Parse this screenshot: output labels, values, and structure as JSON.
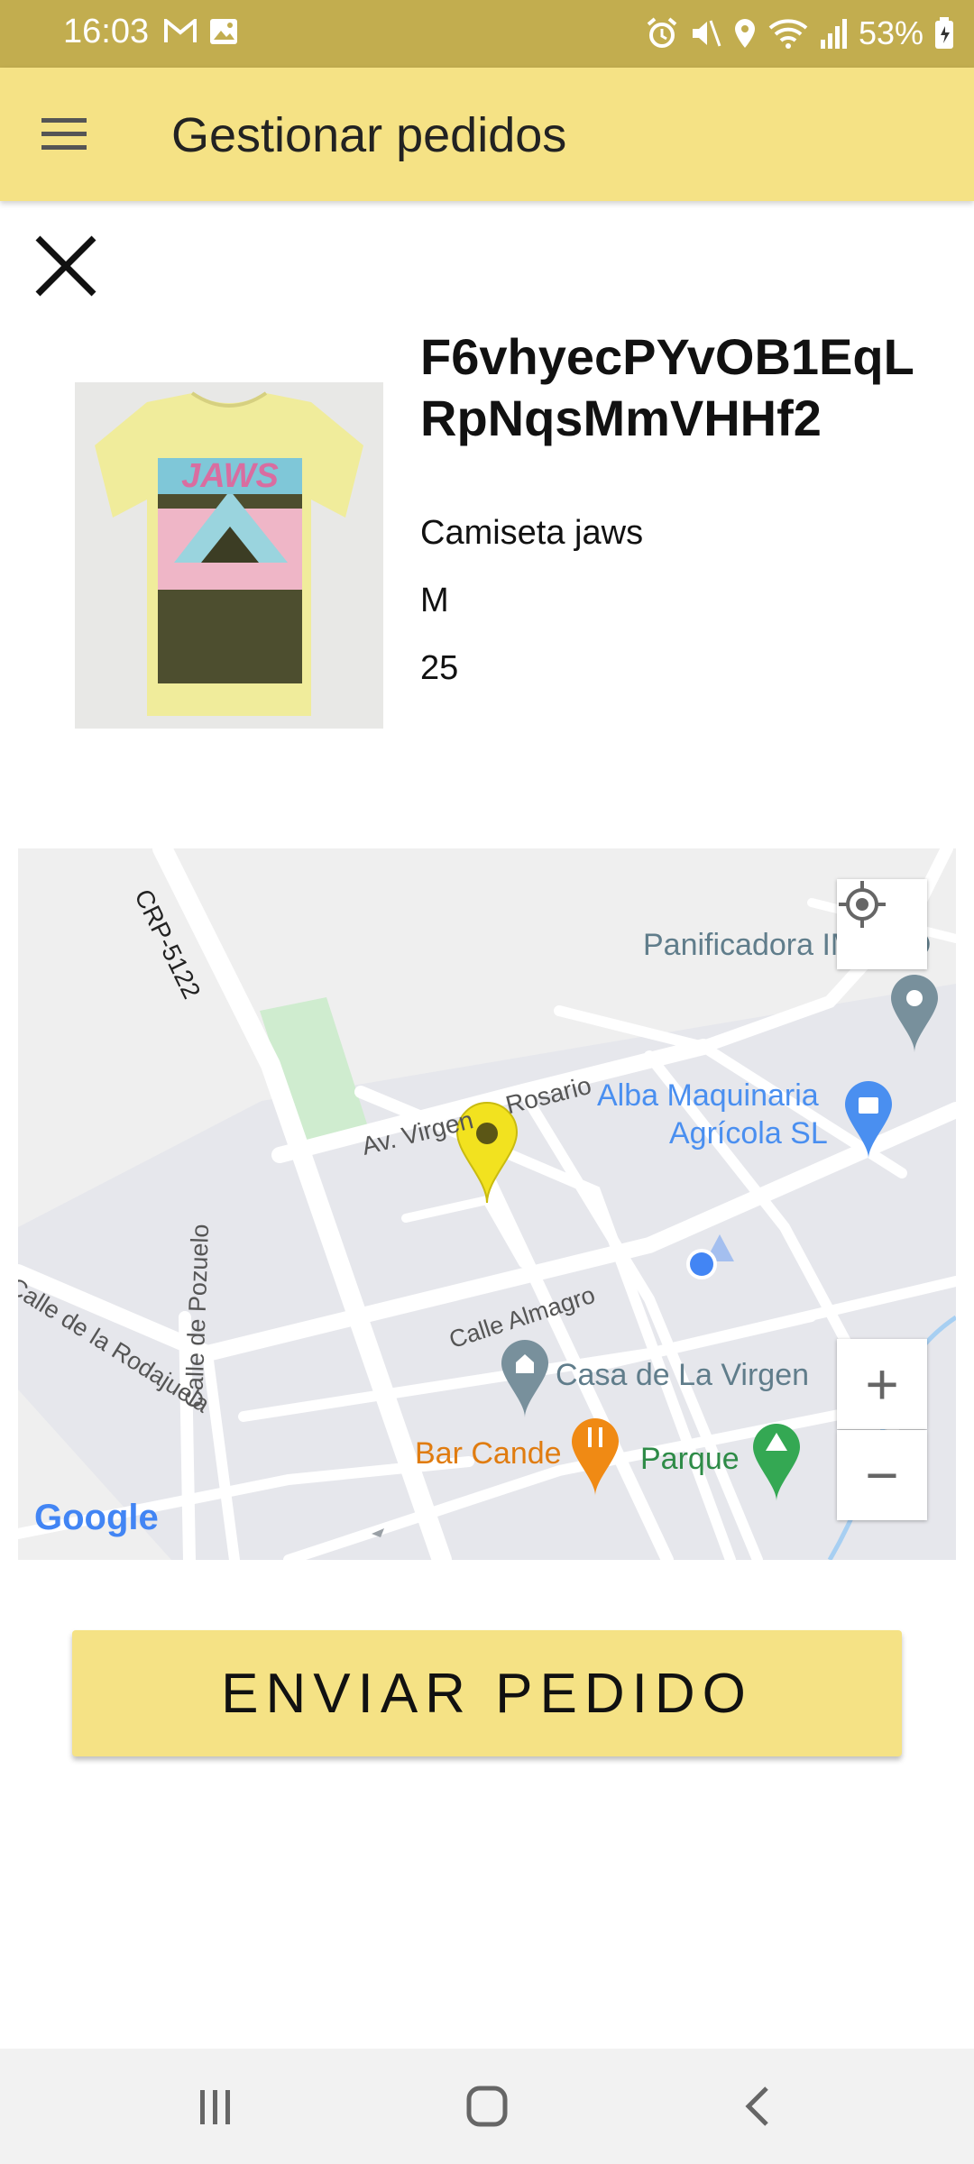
{
  "status_bar": {
    "time": "16:03",
    "battery": "53%"
  },
  "app_bar": {
    "title": "Gestionar pedidos"
  },
  "order": {
    "id": "F6vhyecPYvOB1EqLRpNqsMmVHHf2",
    "product_name": "Camiseta jaws",
    "size": "M",
    "quantity": "25",
    "image_text": "JAWS"
  },
  "map": {
    "labels": {
      "road_crp": "CRP-5122",
      "av_virgen": "Av. Virgen",
      "rosario": "Rosario",
      "panificadora": "Panificadora IMEDIO",
      "alba_line1": "Alba Maquinaria",
      "alba_line2": "Agrícola SL",
      "calle_pozuelo": "Calle de Pozuelo",
      "calle_rodajuela": "Calle de la Rodajuela",
      "calle_almagro": "Calle Almagro",
      "casa_virgen": "Casa de La Virgen",
      "bar_cande": "Bar Cande",
      "parque": "Parque",
      "google": "Google"
    },
    "zoom_in_label": "+",
    "zoom_out_label": "−"
  },
  "actions": {
    "send_label": "ENVIAR PEDIDO"
  },
  "colors": {
    "status_bar": "#c2ad4f",
    "app_bar": "#f5e285",
    "button": "#f5e285",
    "marker": "#f2e21f"
  },
  "icons": {
    "menu": "hamburger-icon",
    "close": "close-icon",
    "locate": "my-location-icon"
  }
}
